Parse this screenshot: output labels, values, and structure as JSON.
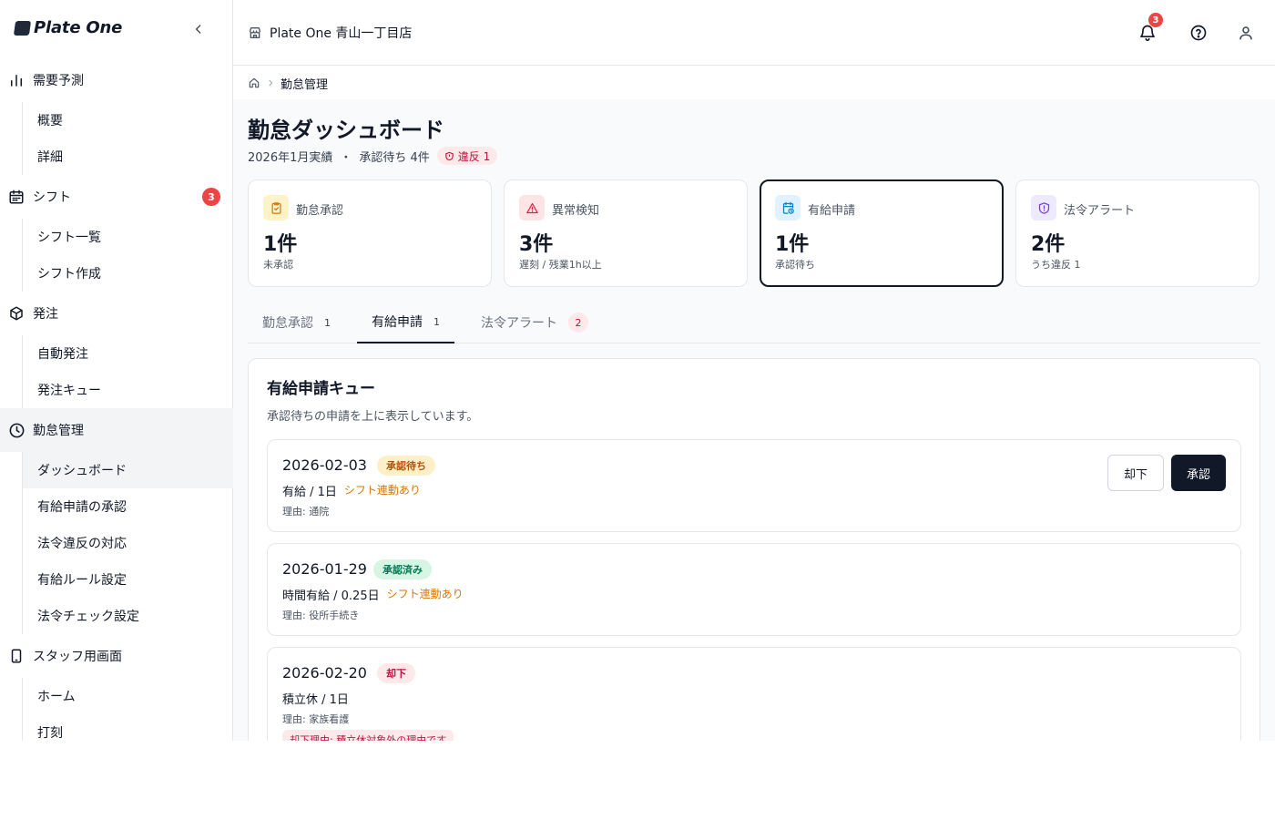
{
  "app": {
    "logo_text": "Plate One"
  },
  "sidebar": {
    "groups": [
      {
        "label": "需要予測",
        "icon": "bar-chart-icon",
        "badge": "",
        "items": [
          "概要",
          "詳細"
        ]
      },
      {
        "label": "シフト",
        "icon": "calendar-icon",
        "badge": "3",
        "items": [
          "シフト一覧",
          "シフト作成"
        ]
      },
      {
        "label": "発注",
        "icon": "package-icon",
        "badge": "",
        "items": [
          "自動発注",
          "発注キュー"
        ]
      },
      {
        "label": "勤怠管理",
        "icon": "clock-icon",
        "badge": "",
        "items": [
          "ダッシュボード",
          "有給申請の承認",
          "法令違反の対応",
          "有給ルール設定",
          "法令チェック設定"
        ]
      },
      {
        "label": "スタッフ用画面",
        "icon": "tablet-icon",
        "badge": "",
        "items": [
          "ホーム",
          "打刻"
        ]
      }
    ]
  },
  "header": {
    "store_name": "Plate One 青山一丁目店",
    "notification_count": "3"
  },
  "breadcrumb": {
    "current": "勤怠管理"
  },
  "page": {
    "title": "勤怠ダッシュボード",
    "period": "2026年1月実績",
    "separator": "・",
    "pending": "承認待ち 4件",
    "violation_badge": "違反 1"
  },
  "stats": [
    {
      "label": "勤怠承認",
      "value": "1件",
      "note": "未承認",
      "icon": "clipboard-check-icon",
      "color": "#d97706",
      "bg": "#fef3c7"
    },
    {
      "label": "異常検知",
      "value": "3件",
      "note": "遅刻 / 残業1h以上",
      "icon": "warning-triangle-icon",
      "color": "#e11d48",
      "bg": "#ffe4e6"
    },
    {
      "label": "有給申請",
      "value": "1件",
      "note": "承認待ち",
      "icon": "calendar-clock-icon",
      "color": "#0284c7",
      "bg": "#e0f2fe"
    },
    {
      "label": "法令アラート",
      "value": "2件",
      "note": "うち違反 1",
      "icon": "shield-alert-icon",
      "color": "#7c3aed",
      "bg": "#ede9fe"
    }
  ],
  "tabs": [
    {
      "label": "勤怠承認",
      "count": "1"
    },
    {
      "label": "有給申請",
      "count": "1"
    },
    {
      "label": "法令アラート",
      "count": "2"
    }
  ],
  "queue": {
    "title": "有給申請キュー",
    "description": "承認待ちの申請を上に表示しています。",
    "reject_label": "却下",
    "approve_label": "承認",
    "requests": [
      {
        "date": "2026-02-03",
        "status": "承認待ち",
        "type": "有給 / 1日",
        "shift": "シフト連動あり",
        "reason": "理由: 通院",
        "reject_reason": ""
      },
      {
        "date": "2026-01-29",
        "status": "承認済み",
        "type": "時間有給 / 0.25日",
        "shift": "シフト連動あり",
        "reason": "理由: 役所手続き",
        "reject_reason": ""
      },
      {
        "date": "2026-02-20",
        "status": "却下",
        "type": "積立休 / 1日",
        "shift": "",
        "reason": "理由: 家族看護",
        "reject_reason": "却下理由: 積立休対象外の理由です"
      }
    ]
  }
}
